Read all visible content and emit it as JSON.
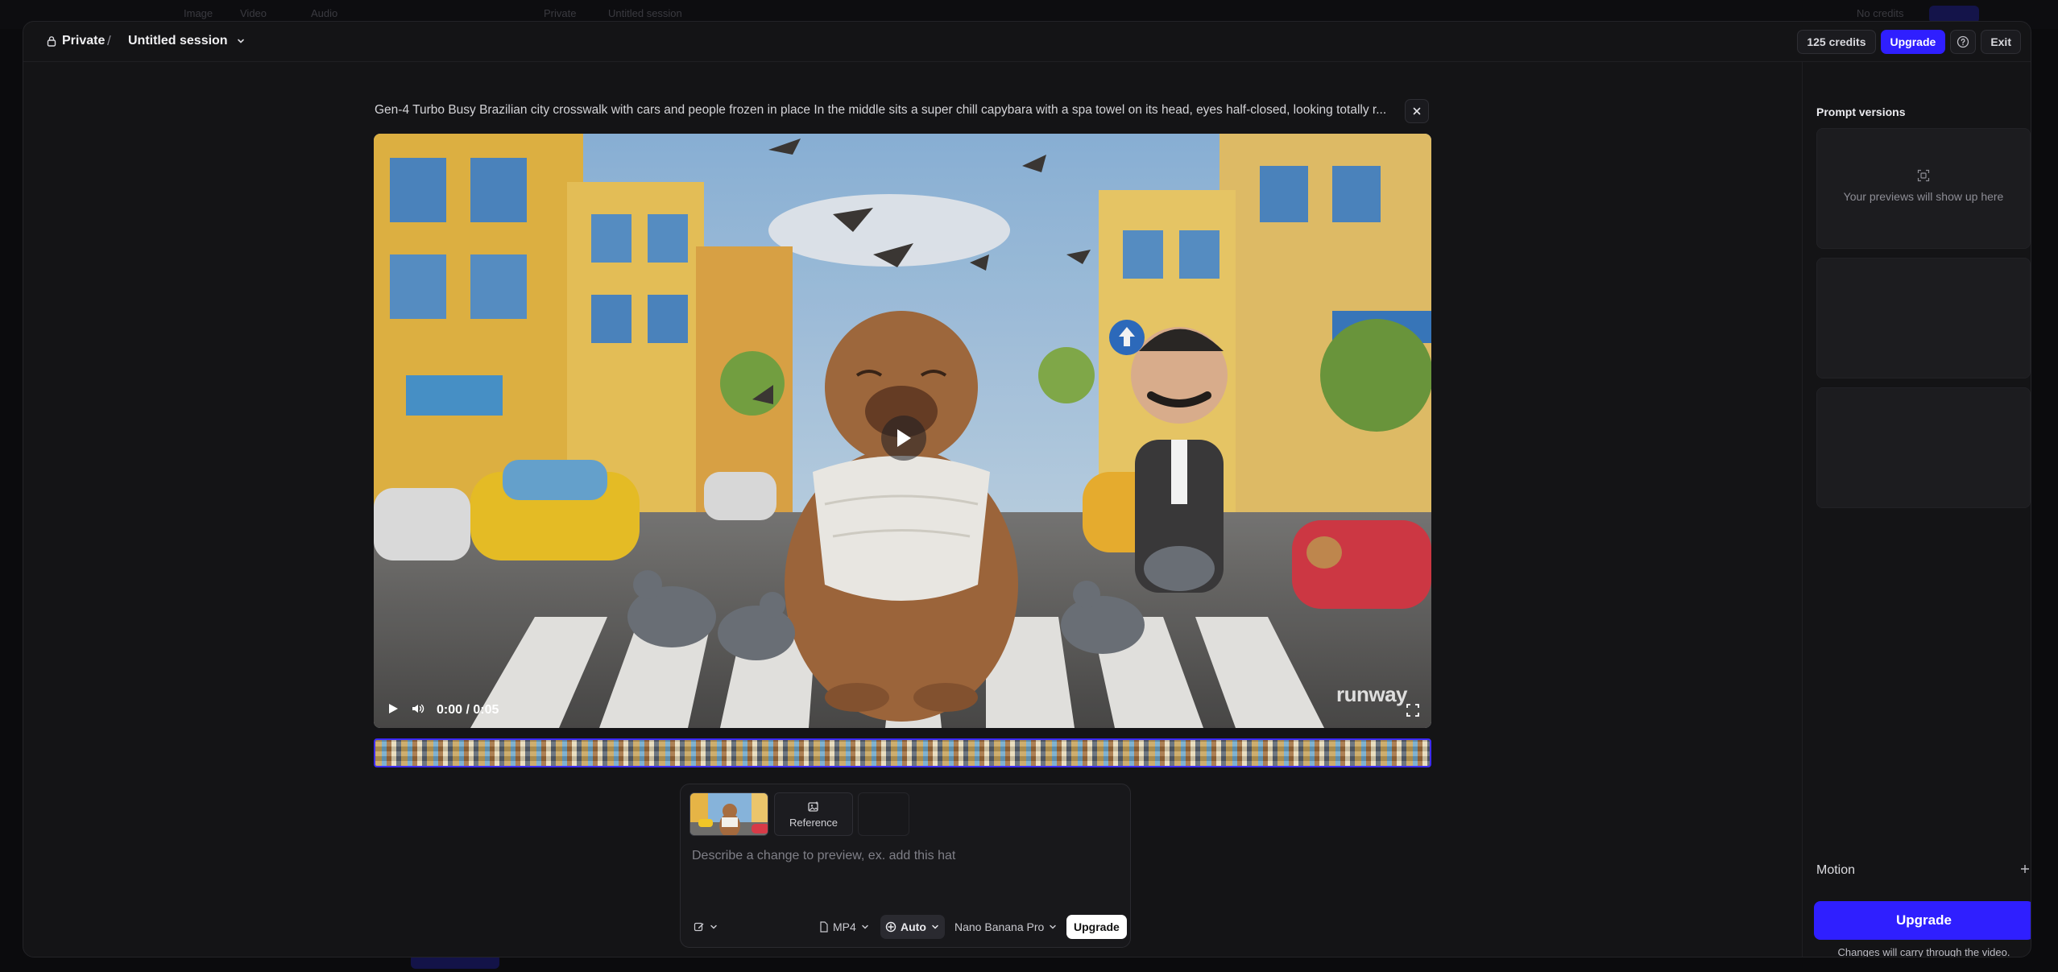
{
  "background": {
    "tabs": [
      "Image",
      "Video",
      "Audio"
    ],
    "crumb": [
      "Private",
      "Untitled session"
    ],
    "credits_text": "No credits",
    "upgrade_label": "Upgrade"
  },
  "header": {
    "visibility": "Private",
    "separator": "/",
    "session_name": "Untitled session",
    "credits": "125 credits",
    "upgrade_label": "Upgrade",
    "help_icon": "help-circle-icon",
    "exit_label": "Exit"
  },
  "video": {
    "prompt": "Gen-4 Turbo Busy Brazilian city crosswalk with cars and people frozen in place In the middle sits a super chill capybara with a spa towel on its head, eyes half-closed, looking totally r...",
    "time": "0:00 / 0:05",
    "watermark": "runway",
    "icons": [
      "play-icon",
      "volume-icon",
      "fullscreen-icon",
      "close-icon"
    ]
  },
  "composer": {
    "reference_label": "Reference",
    "placeholder": "Describe a change to preview, ex. add this hat",
    "format": "MP4",
    "mode": "Auto",
    "model": "Nano Banana Pro",
    "upgrade_label": "Upgrade"
  },
  "panel": {
    "title": "Prompt versions",
    "empty_text": "Your previews will show up here",
    "motion_label": "Motion",
    "upgrade_label": "Upgrade",
    "note": "Changes will carry through the video."
  },
  "colors": {
    "accent": "#2f1fff",
    "surface": "#141416",
    "card": "#1c1c1f"
  }
}
